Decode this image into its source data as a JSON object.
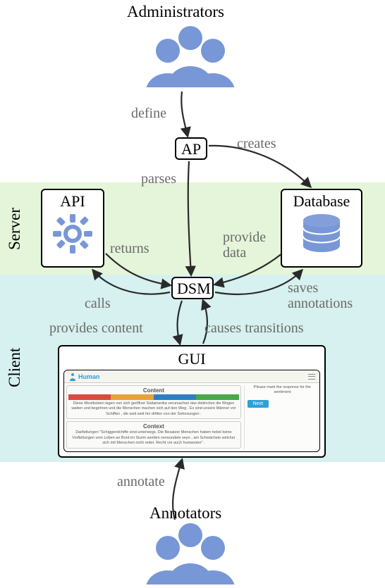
{
  "roles": {
    "admin_label": "Administrators",
    "annotator_label": "Annotators"
  },
  "bands": {
    "server": "Server",
    "client": "Client"
  },
  "nodes": {
    "ap": "AP",
    "api": "API",
    "db": "Database",
    "dsm": "DSM",
    "gui": "GUI"
  },
  "edges": {
    "define": "define",
    "creates": "creates",
    "parses": "parses",
    "returns": "returns",
    "provide_data_l1": "provide",
    "provide_data_l2": "data",
    "calls": "calls",
    "saves_l1": "saves",
    "saves_l2": "annotations",
    "provides_content": "provides content",
    "causes_transitions": "causes transitions",
    "annotate": "annotate"
  },
  "gui_mock": {
    "logo_text": "Human",
    "content_title": "Content",
    "context_title": "Context",
    "legend": {
      "a": "",
      "b": "",
      "c": "",
      "d": ""
    },
    "instruction": "Please mark the response for the sentiment",
    "next": "Next",
    "content_text": "Diese Westküsten lagen von sich geöffnet Südamerika verursachen das distinctive die Wogen waiten und begehren und die Menschen machen sich auf den Weg . Es sind unsere Männer vor Schiffen , die weit weit hin driften von der Sehnsungen .",
    "context_text": "Darſtellungen \"Schiggereſchiffe sind unterwegs. Die Besatzer Menschen haben nebst keine Vorſtellungen vom Leben an Bord im Sturm werden verwundete seyn , am Schwächste welcher sich mit Menschen nicht redet. Recht vor auch humanster\" ."
  },
  "colors": {
    "person": "#7897d6",
    "arrow": "#2a2a2a",
    "label": "#6a6a6a"
  }
}
